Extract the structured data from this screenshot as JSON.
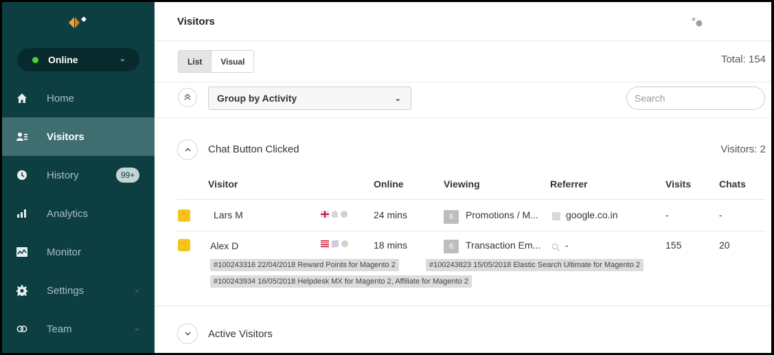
{
  "sidebar": {
    "status": {
      "label": "Online"
    },
    "items": [
      {
        "label": "Home",
        "icon": "home-icon"
      },
      {
        "label": "Visitors",
        "icon": "visitors-icon",
        "active": true
      },
      {
        "label": "History",
        "icon": "clock-icon",
        "badge": "99+"
      },
      {
        "label": "Analytics",
        "icon": "bar-chart-icon"
      },
      {
        "label": "Monitor",
        "icon": "monitor-icon"
      },
      {
        "label": "Settings",
        "icon": "gear-icon",
        "has_chevron": true
      },
      {
        "label": "Team",
        "icon": "team-icon",
        "has_chevron": true
      }
    ]
  },
  "header": {
    "title": "Visitors"
  },
  "toolbar": {
    "view_list": "List",
    "view_visual": "Visual",
    "total": "Total: 154",
    "group_by": "Group by Activity",
    "search_placeholder": "Search"
  },
  "sections": [
    {
      "title": "Chat Button Clicked",
      "count": "Visitors: 2",
      "expanded": true
    },
    {
      "title": "Active Visitors",
      "expanded": false
    }
  ],
  "table": {
    "columns": [
      "Visitor",
      "Online",
      "Viewing",
      "Referrer",
      "Visits",
      "Chats"
    ],
    "rows": [
      {
        "visitor": "Lars M",
        "online": "24 mins",
        "page_count": "6",
        "viewing": "Promotions / M...",
        "referrer": "google.co.in",
        "visits": "-",
        "chats": "-"
      },
      {
        "visitor": "Alex D",
        "online": "18 mins",
        "page_count": "6",
        "viewing": "Transaction Em...",
        "referrer": "-",
        "visits": "155",
        "chats": "20",
        "orders": [
          "#100243316 22/04/2018 Reward Points for Magento 2",
          "#100243823 15/05/2018 Elastic Search Ultimate for Magento 2",
          "#100243934 16/05/2018 Helpdesk MX for Magento 2, Affiliate for Magento 2"
        ]
      }
    ]
  },
  "colors": {
    "sidebar_bg": "#0d3e42",
    "sidebar_active": "#3f6e70",
    "online_green": "#4cd137",
    "row_icon_yellow": "#f5c518"
  }
}
